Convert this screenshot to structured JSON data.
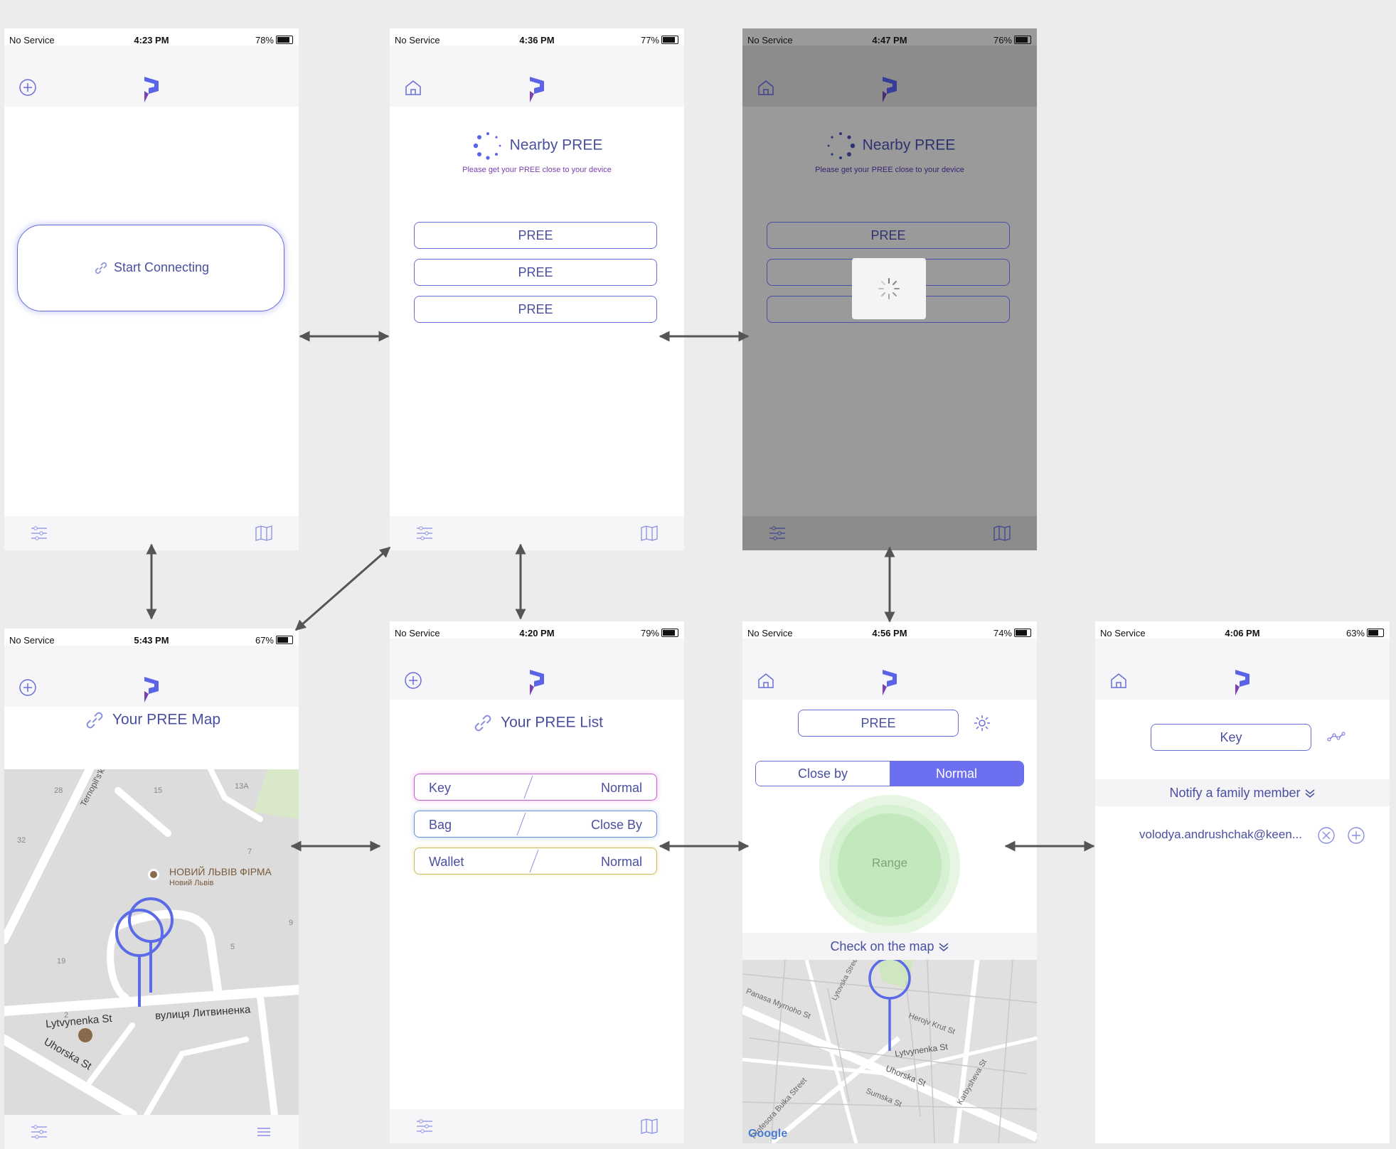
{
  "colors": {
    "accent": "#5b63e6",
    "text": "#4a4fa0",
    "bar": "#f6f6f8"
  },
  "screens": {
    "s1": {
      "status": {
        "carrier": "No Service",
        "time": "4:23 PM",
        "battery": "78%"
      },
      "top_icon": "plus-circle-icon",
      "button": "Start Connecting"
    },
    "s2": {
      "status": {
        "carrier": "No Service",
        "time": "4:36 PM",
        "battery": "77%"
      },
      "top_icon": "home-icon",
      "title": "Nearby PREE",
      "subtitle": "Please get your PREE close to your device",
      "items": [
        "PREE",
        "PREE",
        "PREE"
      ]
    },
    "s3": {
      "status": {
        "carrier": "No Service",
        "time": "4:47 PM",
        "battery": "76%"
      },
      "top_icon": "home-icon",
      "title": "Nearby PREE",
      "subtitle": "Please get your PREE close to your device",
      "items": [
        "PREE"
      ]
    },
    "s4": {
      "status": {
        "carrier": "No Service",
        "time": "5:43 PM",
        "battery": "67%"
      },
      "top_icon": "plus-circle-icon",
      "title": "Your PREE Map",
      "map_labels": {
        "street1": "Ternopil's'ka St",
        "street2": "Lytvynenka St",
        "street3": "вулиця Литвиненка",
        "street4": "Uhorska St",
        "poi": "НОВИЙ ЛЬВІВ ФІРМА",
        "poi_sub": "Новий Львів",
        "n28": "28",
        "n15": "15",
        "n13a": "13A",
        "n32": "32",
        "n7": "7",
        "n5": "5",
        "n9": "9",
        "n19": "19",
        "n2": "2"
      }
    },
    "s5": {
      "status": {
        "carrier": "No Service",
        "time": "4:20 PM",
        "battery": "79%"
      },
      "top_icon": "plus-circle-icon",
      "title": "Your PREE List",
      "rows": [
        {
          "name": "Key",
          "mode": "Normal"
        },
        {
          "name": "Bag",
          "mode": "Close By"
        },
        {
          "name": "Wallet",
          "mode": "Normal"
        }
      ]
    },
    "s6": {
      "status": {
        "carrier": "No Service",
        "time": "4:56 PM",
        "battery": "74%"
      },
      "top_icon": "home-icon",
      "device": "PREE",
      "seg_left": "Close by",
      "seg_right": "Normal",
      "range": "Range",
      "check_map": "Check on the map",
      "google": "Google",
      "map_labels": {
        "a": "Panasa Myrnoho St",
        "b": "Lytvynenka St",
        "c": "Uhorska St",
        "d": "Sumska St",
        "e": "Profesora Buika Street",
        "f": "Herojv Krut St",
        "g": "Karbysheva St",
        "h": "Lytovska Street"
      }
    },
    "s7": {
      "status": {
        "carrier": "No Service",
        "time": "4:06 PM",
        "battery": "63%"
      },
      "top_icon": "home-icon",
      "device": "Key",
      "notify": "Notify a family member",
      "email": "volodya.andrushchak@keen..."
    }
  }
}
